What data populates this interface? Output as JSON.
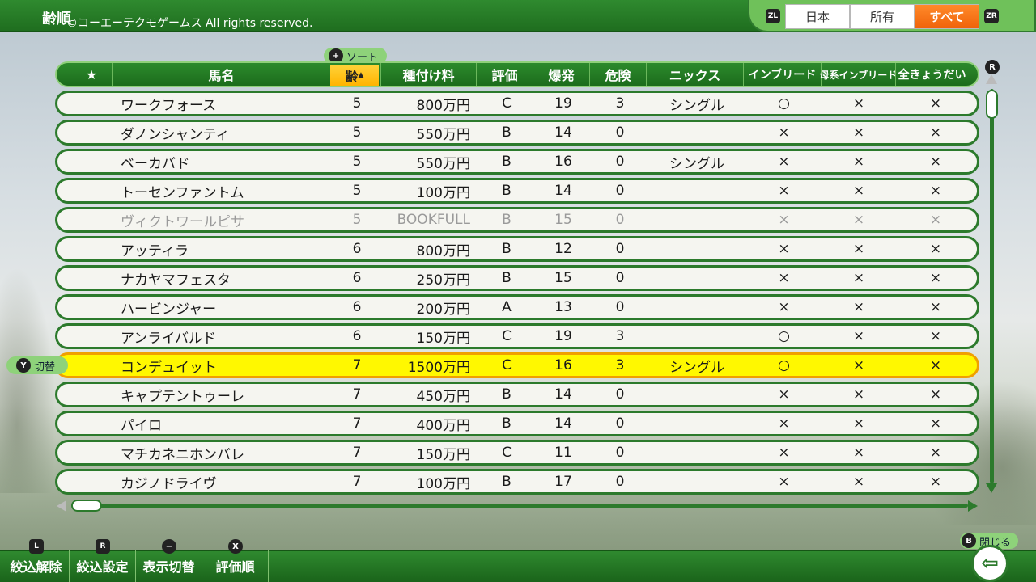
{
  "top": {
    "page_title": "齢順",
    "copyright": "©コーエーテクモゲームス All rights reserved.",
    "zl_glyph": "ZL",
    "zr_glyph": "ZR",
    "region_tabs": [
      "日本",
      "所有",
      "すべて"
    ],
    "region_active": "すべて"
  },
  "sort_hint": {
    "glyph": "+",
    "label": "ソート"
  },
  "switch_hint": {
    "glyph": "Y",
    "label": "切替"
  },
  "close_hint": {
    "glyph": "B",
    "label": "閉じる"
  },
  "scroll_glyph": "R",
  "headers": {
    "star": "★",
    "name": "馬名",
    "age": "齢",
    "age_sort_mark": "▲",
    "fee": "種付け料",
    "grade": "評価",
    "burst": "爆発",
    "risk": "危険",
    "nicks": "ニックス",
    "inbreed": "インブリード",
    "dam_inbreed": "母系インブリード",
    "siblings": "全きょうだい"
  },
  "rows": [
    {
      "name": "ワークフォース",
      "age": "5",
      "fee": "800万円",
      "grade": "C",
      "burst": "19",
      "risk": "3",
      "nicks": "シングル",
      "inbreed": "○",
      "dam": "×",
      "sib": "×",
      "state": "normal"
    },
    {
      "name": "ダノンシャンティ",
      "age": "5",
      "fee": "550万円",
      "grade": "B",
      "burst": "14",
      "risk": "0",
      "nicks": "",
      "inbreed": "×",
      "dam": "×",
      "sib": "×",
      "state": "normal"
    },
    {
      "name": "ベーカバド",
      "age": "5",
      "fee": "550万円",
      "grade": "B",
      "burst": "16",
      "risk": "0",
      "nicks": "シングル",
      "inbreed": "×",
      "dam": "×",
      "sib": "×",
      "state": "normal"
    },
    {
      "name": "トーセンファントム",
      "age": "5",
      "fee": "100万円",
      "grade": "B",
      "burst": "14",
      "risk": "0",
      "nicks": "",
      "inbreed": "×",
      "dam": "×",
      "sib": "×",
      "state": "normal"
    },
    {
      "name": "ヴィクトワールピサ",
      "age": "5",
      "fee": "BOOKFULL",
      "grade": "B",
      "burst": "15",
      "risk": "0",
      "nicks": "",
      "inbreed": "×",
      "dam": "×",
      "sib": "×",
      "state": "disabled"
    },
    {
      "name": "アッティラ",
      "age": "6",
      "fee": "800万円",
      "grade": "B",
      "burst": "12",
      "risk": "0",
      "nicks": "",
      "inbreed": "×",
      "dam": "×",
      "sib": "×",
      "state": "normal"
    },
    {
      "name": "ナカヤマフェスタ",
      "age": "6",
      "fee": "250万円",
      "grade": "B",
      "burst": "15",
      "risk": "0",
      "nicks": "",
      "inbreed": "×",
      "dam": "×",
      "sib": "×",
      "state": "normal"
    },
    {
      "name": "ハービンジャー",
      "age": "6",
      "fee": "200万円",
      "grade": "A",
      "burst": "13",
      "risk": "0",
      "nicks": "",
      "inbreed": "×",
      "dam": "×",
      "sib": "×",
      "state": "normal"
    },
    {
      "name": "アンライバルド",
      "age": "6",
      "fee": "150万円",
      "grade": "C",
      "burst": "19",
      "risk": "3",
      "nicks": "",
      "inbreed": "○",
      "dam": "×",
      "sib": "×",
      "state": "normal"
    },
    {
      "name": "コンデュイット",
      "age": "7",
      "fee": "1500万円",
      "grade": "C",
      "burst": "16",
      "risk": "3",
      "nicks": "シングル",
      "inbreed": "○",
      "dam": "×",
      "sib": "×",
      "state": "selected"
    },
    {
      "name": "キャプテントゥーレ",
      "age": "7",
      "fee": "450万円",
      "grade": "B",
      "burst": "14",
      "risk": "0",
      "nicks": "",
      "inbreed": "×",
      "dam": "×",
      "sib": "×",
      "state": "normal"
    },
    {
      "name": "パイロ",
      "age": "7",
      "fee": "400万円",
      "grade": "B",
      "burst": "14",
      "risk": "0",
      "nicks": "",
      "inbreed": "×",
      "dam": "×",
      "sib": "×",
      "state": "normal"
    },
    {
      "name": "マチカネニホンバレ",
      "age": "7",
      "fee": "150万円",
      "grade": "C",
      "burst": "11",
      "risk": "0",
      "nicks": "",
      "inbreed": "×",
      "dam": "×",
      "sib": "×",
      "state": "normal"
    },
    {
      "name": "カジノドライヴ",
      "age": "7",
      "fee": "100万円",
      "grade": "B",
      "burst": "17",
      "risk": "0",
      "nicks": "",
      "inbreed": "×",
      "dam": "×",
      "sib": "×",
      "state": "normal"
    }
  ],
  "bottom_buttons": [
    {
      "glyph": "L",
      "label": "絞込解除"
    },
    {
      "glyph": "R",
      "label": "絞込設定"
    },
    {
      "glyph": "−",
      "label": "表示切替"
    },
    {
      "glyph": "X",
      "label": "評価順"
    }
  ],
  "colors": {
    "bar_green": "#2f8a2f",
    "selected_row": "#fff800",
    "active_tab": "#f0630a",
    "sorted_header": "#ffb400"
  }
}
